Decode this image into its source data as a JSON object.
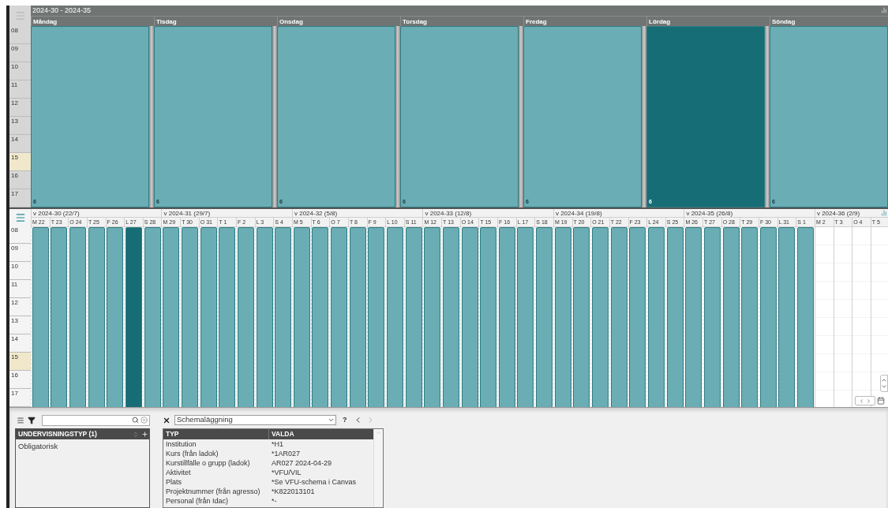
{
  "overview": {
    "title": "2024-30 - 2024-35",
    "hours": [
      {
        "label": "08",
        "highlighted": false
      },
      {
        "label": "09",
        "highlighted": false
      },
      {
        "label": "10",
        "highlighted": false
      },
      {
        "label": "11",
        "highlighted": false
      },
      {
        "label": "12",
        "highlighted": false
      },
      {
        "label": "13",
        "highlighted": false
      },
      {
        "label": "14",
        "highlighted": false
      },
      {
        "label": "15",
        "highlighted": true
      },
      {
        "label": "16",
        "highlighted": false
      },
      {
        "label": "17",
        "highlighted": false
      }
    ],
    "days": [
      {
        "name": "Måndag",
        "count": "6",
        "selected": false
      },
      {
        "name": "Tisdag",
        "count": "6",
        "selected": false
      },
      {
        "name": "Onsdag",
        "count": "6",
        "selected": false
      },
      {
        "name": "Torsdag",
        "count": "6",
        "selected": false
      },
      {
        "name": "Fredag",
        "count": "6",
        "selected": false
      },
      {
        "name": "Lördag",
        "count": "6",
        "selected": true
      },
      {
        "name": "Söndag",
        "count": "6",
        "selected": false
      }
    ]
  },
  "timeline": {
    "hours": [
      {
        "label": "08",
        "highlighted": false
      },
      {
        "label": "09",
        "highlighted": false
      },
      {
        "label": "10",
        "highlighted": false
      },
      {
        "label": "11",
        "highlighted": false
      },
      {
        "label": "12",
        "highlighted": false
      },
      {
        "label": "13",
        "highlighted": false
      },
      {
        "label": "14",
        "highlighted": false
      },
      {
        "label": "15",
        "highlighted": true
      },
      {
        "label": "16",
        "highlighted": false
      },
      {
        "label": "17",
        "highlighted": false
      }
    ],
    "weeks": [
      {
        "label": "v 2024-30 (22/7)",
        "days": [
          {
            "label": "M 22",
            "booked": true,
            "selected": false
          },
          {
            "label": "T 23",
            "booked": true,
            "selected": false
          },
          {
            "label": "O 24",
            "booked": true,
            "selected": false
          },
          {
            "label": "T 25",
            "booked": true,
            "selected": false
          },
          {
            "label": "F 26",
            "booked": true,
            "selected": false
          },
          {
            "label": "L 27",
            "booked": true,
            "selected": true
          },
          {
            "label": "S 28",
            "booked": true,
            "selected": false
          }
        ]
      },
      {
        "label": "v 2024-31 (29/7)",
        "days": [
          {
            "label": "M 29",
            "booked": true,
            "selected": false
          },
          {
            "label": "T 30",
            "booked": true,
            "selected": false
          },
          {
            "label": "O 31",
            "booked": true,
            "selected": false
          },
          {
            "label": "T 1",
            "booked": true,
            "selected": false
          },
          {
            "label": "F 2",
            "booked": true,
            "selected": false
          },
          {
            "label": "L 3",
            "booked": true,
            "selected": false
          },
          {
            "label": "S 4",
            "booked": true,
            "selected": false
          }
        ]
      },
      {
        "label": "v 2024-32 (5/8)",
        "days": [
          {
            "label": "M 5",
            "booked": true,
            "selected": false
          },
          {
            "label": "T 6",
            "booked": true,
            "selected": false
          },
          {
            "label": "O 7",
            "booked": true,
            "selected": false
          },
          {
            "label": "T 8",
            "booked": true,
            "selected": false
          },
          {
            "label": "F 9",
            "booked": true,
            "selected": false
          },
          {
            "label": "L 10",
            "booked": true,
            "selected": false
          },
          {
            "label": "S 11",
            "booked": true,
            "selected": false
          }
        ]
      },
      {
        "label": "v 2024-33 (12/8)",
        "days": [
          {
            "label": "M 12",
            "booked": true,
            "selected": false
          },
          {
            "label": "T 13",
            "booked": true,
            "selected": false
          },
          {
            "label": "O 14",
            "booked": true,
            "selected": false
          },
          {
            "label": "T 15",
            "booked": true,
            "selected": false
          },
          {
            "label": "F 16",
            "booked": true,
            "selected": false
          },
          {
            "label": "L 17",
            "booked": true,
            "selected": false
          },
          {
            "label": "S 18",
            "booked": true,
            "selected": false
          }
        ]
      },
      {
        "label": "v 2024-34 (19/8)",
        "days": [
          {
            "label": "M 19",
            "booked": true,
            "selected": false
          },
          {
            "label": "T 20",
            "booked": true,
            "selected": false
          },
          {
            "label": "O 21",
            "booked": true,
            "selected": false
          },
          {
            "label": "T 22",
            "booked": true,
            "selected": false
          },
          {
            "label": "F 23",
            "booked": true,
            "selected": false
          },
          {
            "label": "L 24",
            "booked": true,
            "selected": false
          },
          {
            "label": "S 25",
            "booked": true,
            "selected": false
          }
        ]
      },
      {
        "label": "v 2024-35 (26/8)",
        "days": [
          {
            "label": "M 26",
            "booked": true,
            "selected": false
          },
          {
            "label": "T 27",
            "booked": true,
            "selected": false
          },
          {
            "label": "O 28",
            "booked": true,
            "selected": false
          },
          {
            "label": "T 29",
            "booked": true,
            "selected": false
          },
          {
            "label": "F 30",
            "booked": true,
            "selected": false
          },
          {
            "label": "L 31",
            "booked": true,
            "selected": false
          },
          {
            "label": "S 1",
            "booked": true,
            "selected": false
          }
        ]
      },
      {
        "label": "v 2024-36 (2/9)",
        "days": [
          {
            "label": "M 2",
            "booked": false,
            "selected": false
          },
          {
            "label": "T 3",
            "booked": false,
            "selected": false
          },
          {
            "label": "O 4",
            "booked": false,
            "selected": false
          },
          {
            "label": "T 5",
            "booked": false,
            "selected": false
          }
        ]
      }
    ]
  },
  "filter_panel": {
    "list_title": "UNDERVISNINGSTYP (1)",
    "items": [
      "Obligatorisk"
    ]
  },
  "details_panel": {
    "view": "Schemaläggning",
    "help": "?",
    "columns": [
      "TYP",
      "VALDA"
    ],
    "rows": [
      [
        "Institution",
        "*H1"
      ],
      [
        "Kurs (från ladok)",
        "*1AR027"
      ],
      [
        "Kurstillfälle o grupp (ladok)",
        "AR027 2024-04-29"
      ],
      [
        "Aktivitet",
        "*VFU/VIL"
      ],
      [
        "Plats",
        "*Se VFU-schema i Canvas"
      ],
      [
        "Projektnummer (från agresso)",
        "*K822013101"
      ],
      [
        "Personal (från Idac)",
        "*-"
      ]
    ]
  }
}
